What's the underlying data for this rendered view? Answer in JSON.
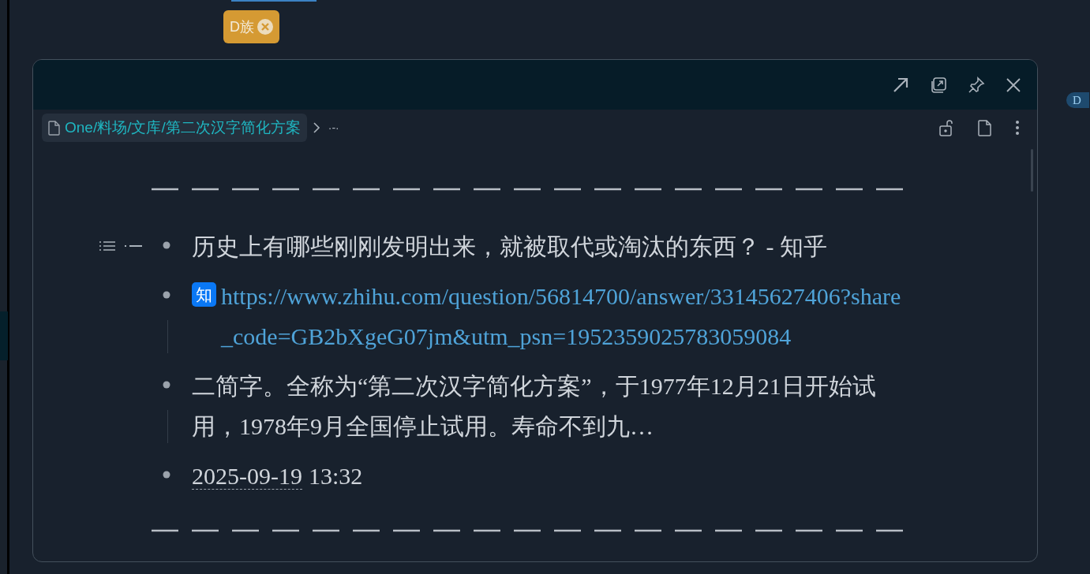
{
  "tag": {
    "label": "D族"
  },
  "side_tag": {
    "label": "D"
  },
  "popover": {
    "breadcrumb": {
      "path": "One/料场/文库/第二次汉字简化方案",
      "child": "·-·"
    },
    "items": [
      {
        "kind": "text",
        "text": "历史上有哪些刚刚发明出来，就被取代或淘汰的东西？ - 知乎"
      },
      {
        "kind": "link",
        "badge": "知",
        "text": "https://www.zhihu.com/question/56814700/answer/33145627406?share_code=GB2bXgeG07jm&utm_psn=1952359025783059084"
      },
      {
        "kind": "text",
        "text": "二简字。全称为“第二次汉字简化方案”，于1977年12月21日开始试用，1978年9月全国停止试用。寿命不到九…"
      },
      {
        "kind": "date",
        "date": "2025-09-19",
        "time": "13:32"
      }
    ]
  }
}
